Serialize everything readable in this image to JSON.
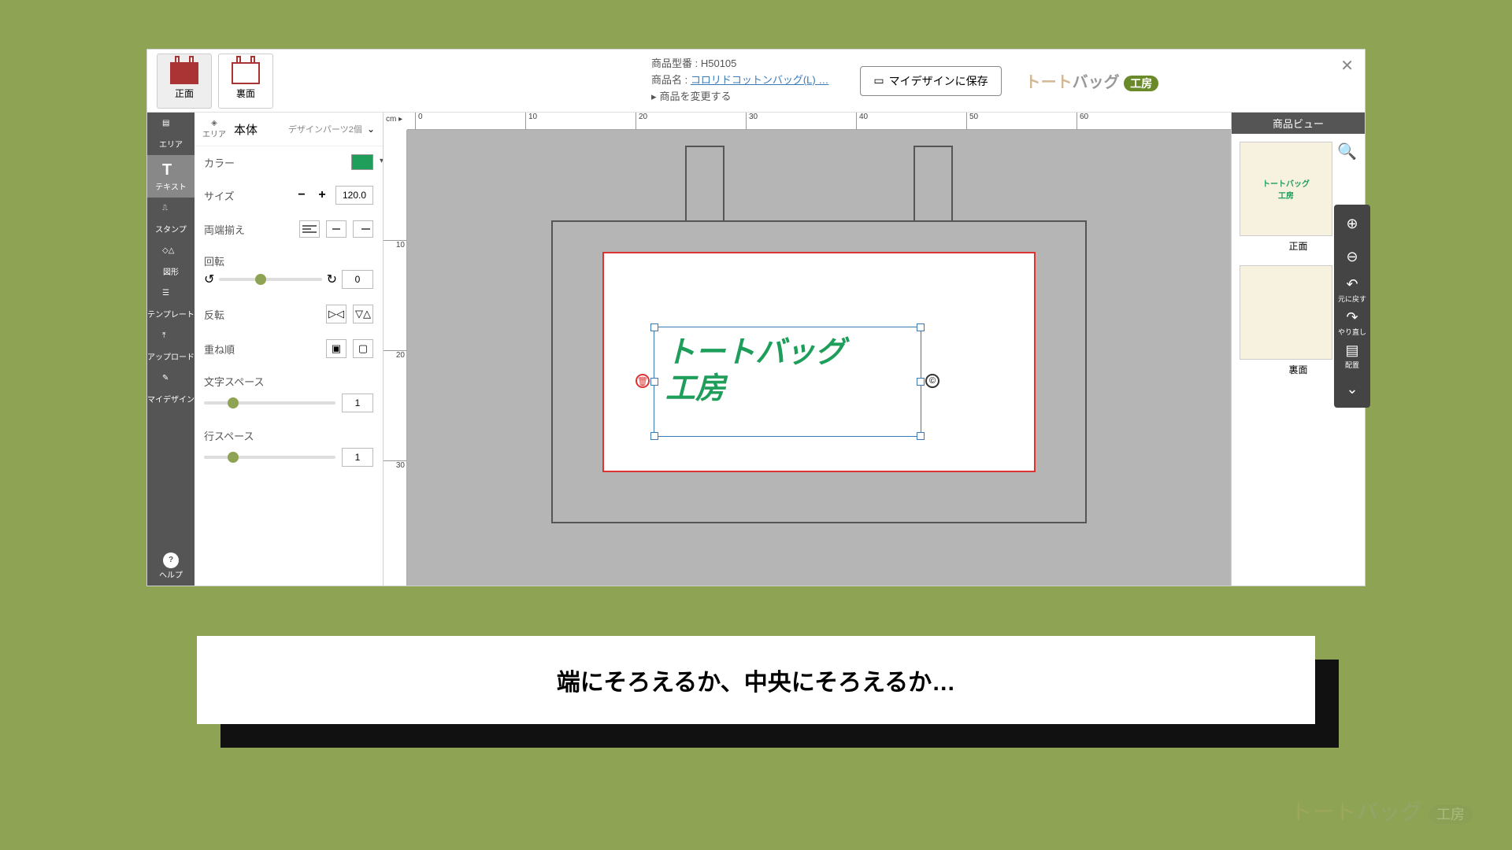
{
  "tabs": {
    "front": "正面",
    "back": "裏面"
  },
  "product": {
    "model_lbl": "商品型番 : ",
    "model": "H50105",
    "name_lbl": "商品名 : ",
    "name": "コロリドコットンバッグ(L) …",
    "change": "商品を変更する"
  },
  "save_btn": "マイデザインに保存",
  "logo": {
    "p1": "トート",
    "p2": "バッグ",
    "badge": "工房"
  },
  "tools": {
    "area": "エリア",
    "text": "テキスト",
    "stamp": "スタンプ",
    "shape": "図形",
    "template": "テンプレート",
    "upload": "アップロード",
    "mydesign": "マイデザイン",
    "help": "ヘルプ"
  },
  "props": {
    "head": {
      "layers": "エリア",
      "title": "本体",
      "parts": "デザインパーツ2個"
    },
    "color": "カラー",
    "size": "サイズ",
    "size_val": "120.0",
    "align": "両端揃え",
    "rotate": "回転",
    "rotate_val": "0",
    "flip": "反転",
    "order": "重ね順",
    "letter_sp": "文字スペース",
    "letter_sp_val": "1",
    "line_sp": "行スペース",
    "line_sp_val": "1"
  },
  "ruler": {
    "unit": "cm",
    "h": [
      "0",
      "10",
      "20",
      "30",
      "40",
      "50",
      "60"
    ],
    "v": [
      "10",
      "20",
      "30"
    ]
  },
  "design_text": {
    "l1": "トートバッグ",
    "l2": "工房"
  },
  "zoom": {
    "undo": "元に戻す",
    "redo": "やり直し",
    "align": "配置"
  },
  "right": {
    "head": "商品ビュー",
    "front": "正面",
    "back": "裏面",
    "thumb_txt": "トートバッグ\n工房"
  },
  "caption": "端にそろえるか、中央にそろえるか…"
}
